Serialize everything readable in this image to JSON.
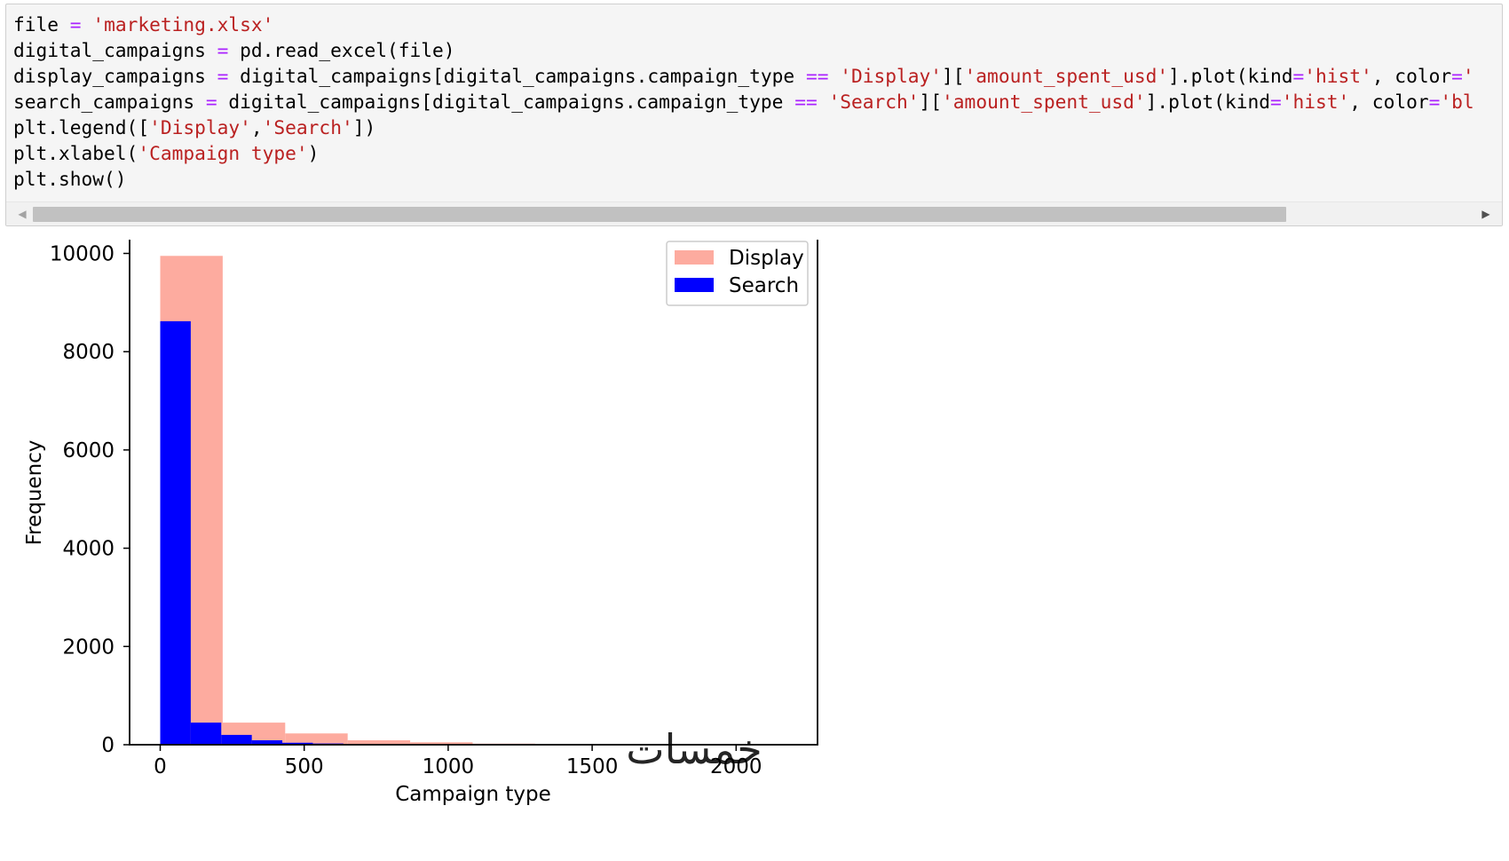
{
  "notebook": {
    "code_lines": [
      [
        {
          "t": "file "
        },
        {
          "t": "=",
          "k": "op"
        },
        {
          "t": " "
        },
        {
          "t": "'marketing.xlsx'",
          "k": "str"
        }
      ],
      [
        {
          "t": "digital_campaigns "
        },
        {
          "t": "=",
          "k": "op"
        },
        {
          "t": " pd.read_excel(file)"
        }
      ],
      [
        {
          "t": "display_campaigns "
        },
        {
          "t": "=",
          "k": "op"
        },
        {
          "t": " digital_campaigns[digital_campaigns.campaign_type "
        },
        {
          "t": "==",
          "k": "op"
        },
        {
          "t": " "
        },
        {
          "t": "'Display'",
          "k": "str"
        },
        {
          "t": "]["
        },
        {
          "t": "'amount_spent_usd'",
          "k": "str"
        },
        {
          "t": "].plot(kind"
        },
        {
          "t": "=",
          "k": "op"
        },
        {
          "t": "'hist'",
          "k": "str"
        },
        {
          "t": ", color"
        },
        {
          "t": "=",
          "k": "op"
        },
        {
          "t": "'",
          "k": "str"
        }
      ],
      [
        {
          "t": "search_campaigns "
        },
        {
          "t": "=",
          "k": "op"
        },
        {
          "t": " digital_campaigns[digital_campaigns.campaign_type "
        },
        {
          "t": "==",
          "k": "op"
        },
        {
          "t": " "
        },
        {
          "t": "'Search'",
          "k": "str"
        },
        {
          "t": "]["
        },
        {
          "t": "'amount_spent_usd'",
          "k": "str"
        },
        {
          "t": "].plot(kind"
        },
        {
          "t": "=",
          "k": "op"
        },
        {
          "t": "'hist'",
          "k": "str"
        },
        {
          "t": ", color"
        },
        {
          "t": "=",
          "k": "op"
        },
        {
          "t": "'bl",
          "k": "str"
        }
      ],
      [
        {
          "t": "plt.legend(["
        },
        {
          "t": "'Display'",
          "k": "str"
        },
        {
          "t": ","
        },
        {
          "t": "'Search'",
          "k": "str"
        },
        {
          "t": "])"
        }
      ],
      [
        {
          "t": "plt.xlabel("
        },
        {
          "t": "'Campaign type'",
          "k": "str"
        },
        {
          "t": ")"
        }
      ],
      [
        {
          "t": "plt.show()"
        }
      ]
    ],
    "scroll_left_icon": "◀",
    "scroll_right_icon": "▶",
    "scroll_position": 0.0,
    "scroll_visible_fraction": 0.84
  },
  "watermark": "خمسات",
  "chart_data": {
    "type": "bar",
    "subtype": "histogram",
    "xlabel": "Campaign type",
    "ylabel": "Frequency",
    "xlim": [
      -100,
      2270
    ],
    "ylim": [
      0,
      10500
    ],
    "xticks": [
      0,
      500,
      1000,
      1500,
      2000
    ],
    "yticks": [
      0,
      2000,
      4000,
      6000,
      8000,
      10000
    ],
    "legend_position": "top-right",
    "series": [
      {
        "name": "Display",
        "color": "#fdab9f",
        "bin_edges": [
          0,
          217,
          434,
          651,
          868,
          1085,
          1302,
          1519,
          1736,
          1953,
          2170
        ],
        "counts": [
          9950,
          450,
          230,
          90,
          50,
          22,
          10,
          6,
          3,
          2
        ]
      },
      {
        "name": "Search",
        "color": "#0000ff",
        "bin_edges": [
          0,
          106,
          212,
          318,
          424,
          530,
          636,
          742,
          848,
          954,
          1060
        ],
        "counts": [
          8620,
          450,
          200,
          90,
          40,
          25,
          12,
          6,
          3,
          2
        ]
      }
    ]
  }
}
